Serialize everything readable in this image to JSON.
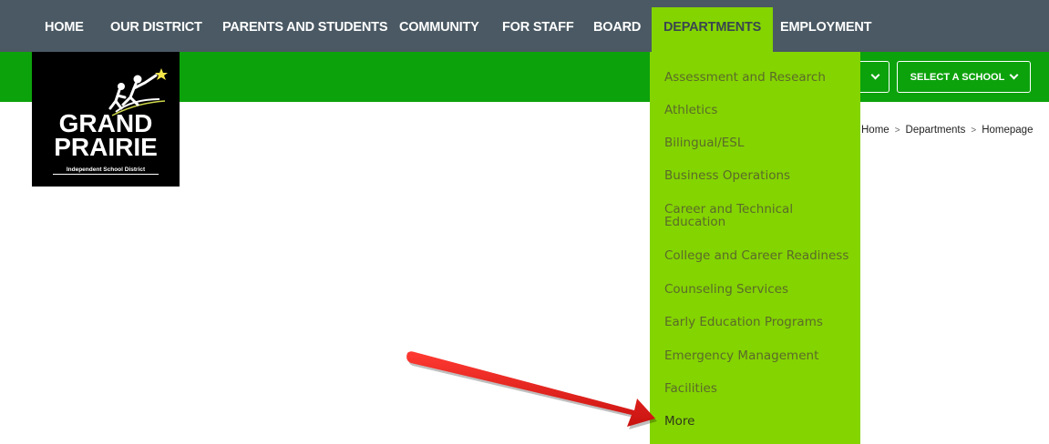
{
  "nav": {
    "items": [
      {
        "label": "HOME"
      },
      {
        "label": "OUR DISTRICT"
      },
      {
        "label": "PARENTS AND STUDENTS"
      },
      {
        "label": "COMMUNITY"
      },
      {
        "label": "FOR STAFF"
      },
      {
        "label": "BOARD"
      },
      {
        "label": "DEPARTMENTS",
        "active": true
      },
      {
        "label": "EMPLOYMENT"
      }
    ]
  },
  "logo": {
    "line1": "GRAND",
    "line2": "PRAIRIE",
    "subtitle": "Independent School District"
  },
  "school_select": {
    "label": "SELECT A SCHOOL"
  },
  "breadcrumb": {
    "items": [
      "Home",
      "Departments",
      "Homepage"
    ],
    "separator": ">"
  },
  "departments_menu": {
    "items": [
      "Assessment and Research",
      "Athletics",
      "Bilingual/ESL",
      "Business Operations",
      "Career and Technical Education",
      "College and Career Readiness",
      "Counseling Services",
      "Early Education Programs",
      "Emergency Management",
      "Facilities",
      "More"
    ]
  },
  "colors": {
    "nav_bg": "#4a5963",
    "green_bar": "#0ca20c",
    "dropdown_bg": "#84d400",
    "arrow": "#e0201c"
  }
}
